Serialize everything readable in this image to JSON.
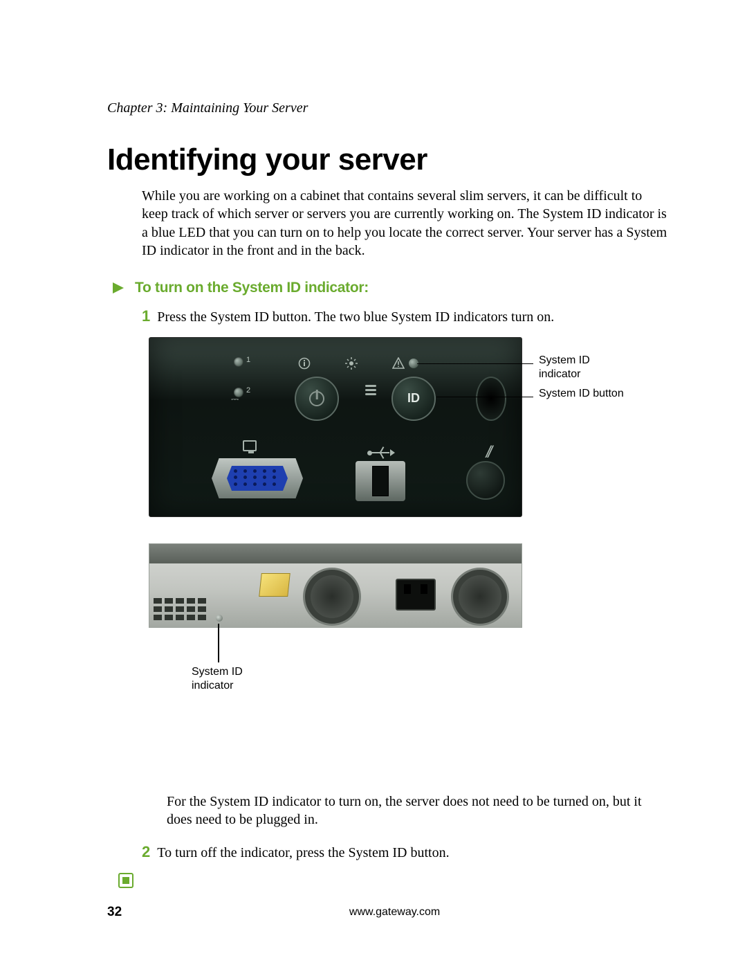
{
  "chapter_header": "Chapter 3: Maintaining Your Server",
  "main_heading": "Identifying your server",
  "intro_text": "While you are working on a cabinet that contains several slim servers, it can be difficult to keep track of which server or servers you are currently working on. The System ID indicator is a blue LED that you can turn on to help you locate the correct server. Your server has a System ID indicator in the front and in the back.",
  "subheading": "To turn on the System ID indicator:",
  "steps": {
    "s1": {
      "num": "1",
      "text": "Press the System ID button. The two blue System ID indicators turn on."
    },
    "s2": {
      "num": "2",
      "text": "To turn off the indicator, press the System ID button."
    }
  },
  "figure1": {
    "callout_indicator": "System ID indicator",
    "callout_button": "System ID button",
    "id_label": "ID",
    "led_1": "1",
    "led_2": "2",
    "dslash": "//"
  },
  "figure2": {
    "callout_indicator": "System ID indicator"
  },
  "note_text": "For the System ID indicator to turn on, the server does not need to be turned on, but it does need to be plugged in.",
  "footer": {
    "page_number": "32",
    "url": "www.gateway.com"
  }
}
